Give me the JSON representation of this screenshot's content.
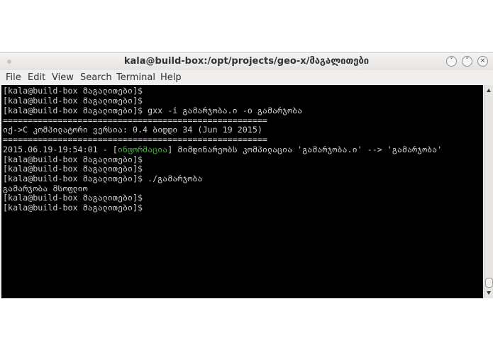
{
  "window": {
    "title": "kala@build-box:/opt/projects/geo-x/მაგალითები",
    "minimize_glyph": "˅",
    "maximize_glyph": "˄",
    "close_glyph": "×"
  },
  "menu": {
    "items": [
      "File",
      "Edit",
      "View",
      "Search",
      "Terminal",
      "Help"
    ]
  },
  "terminal": {
    "lines": [
      "[kala@build-box მაგალითები]$",
      "[kala@build-box მაგალითები]$",
      "[kala@build-box მაგალითები]$ gxx -i გამარჯობა.ი -o გამარჯობა",
      "=====================================================",
      "იქ->C კომპილატორი ვერსია: 0.4 ბიდდი 34 (Jun 19 2015)",
      "=====================================================",
      {
        "pre": "2015.06.19-19:54:01 - [",
        "tag": "ინფორმაცია",
        "post": "] მიმდინარეობს კომპილაცია 'გამარჯობა.ი' --> 'გამარჯობა'"
      },
      "[kala@build-box მაგალითები]$",
      "[kala@build-box მაგალითები]$",
      "[kala@build-box მაგალითები]$ ./გამარჯობა",
      "გამარჯობა მსოფლიო",
      "[kala@build-box მაგალითები]$",
      "[kala@build-box მაგალითები]$"
    ]
  },
  "colors": {
    "terminal_bg": "#000000",
    "terminal_fg": "#d0d0d0",
    "info_tag": "#4cb043"
  }
}
